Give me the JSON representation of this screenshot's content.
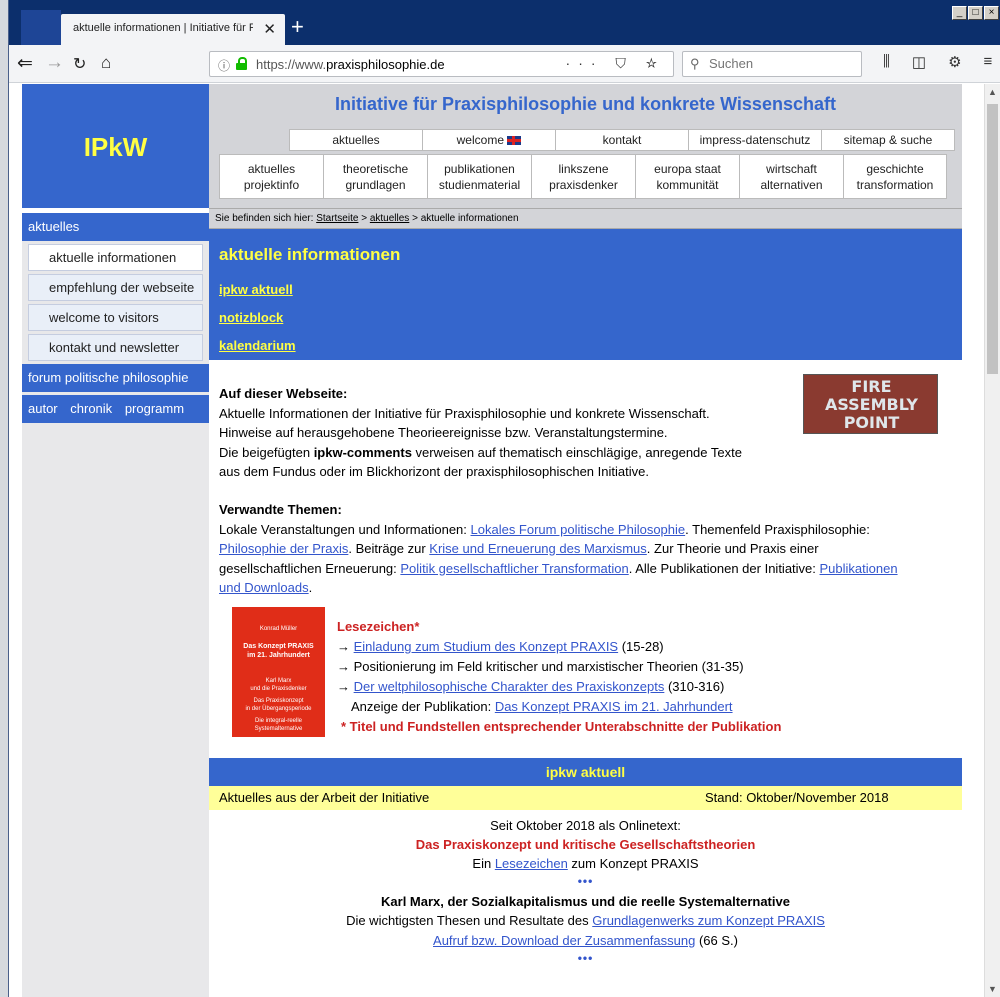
{
  "browser": {
    "tab_title": "aktuelle informationen | Initiative für Pr",
    "tab_close": "✕",
    "new_tab": "+",
    "url_prefix": "https://www.",
    "url_domain": "praxisphilosophie.de",
    "url_actions": "··· ⛉ ☆",
    "search_placeholder": "Suchen"
  },
  "site": {
    "logo": "IPkW",
    "title": "Initiative für Praxisphilosophie und konkrete Wissenschaft"
  },
  "nav_top": [
    "aktuelles",
    "welcome",
    "kontakt",
    "impress-datenschutz",
    "sitemap & suche"
  ],
  "nav_main": [
    {
      "l1": "aktuelles",
      "l2": "projektinfo"
    },
    {
      "l1": "theoretische",
      "l2": "grundlagen"
    },
    {
      "l1": "publikationen",
      "l2": "studienmaterial"
    },
    {
      "l1": "linkszene",
      "l2": "praxisdenker"
    },
    {
      "l1": "europa staat",
      "l2": "kommunität"
    },
    {
      "l1": "wirtschaft",
      "l2": "alternativen"
    },
    {
      "l1": "geschichte",
      "l2": "transformation"
    }
  ],
  "sidebar": {
    "head": "aktuelles",
    "items": [
      "aktuelle informationen",
      "empfehlung der webseite",
      "welcome to visitors",
      "kontakt und newsletter"
    ],
    "forum": "forum politische philosophie",
    "bottom": [
      "autor",
      "chronik",
      "programm"
    ]
  },
  "breadcrumb": {
    "prefix": "Sie befinden sich hier:",
    "home": "Startseite",
    "sep": ">",
    "section": "aktuelles",
    "current": "aktuelle informationen"
  },
  "hero": {
    "title": "aktuelle informationen",
    "links": [
      "ipkw aktuell",
      "notizblock",
      "kalendarium"
    ]
  },
  "intro": {
    "heading": "Auf dieser Webseite:",
    "line1": "Aktuelle Informationen der Initiative für Praxisphilosophie und konkrete Wissenschaft.",
    "line2": "Hinweise auf herausgehobene Theorieereignisse bzw. Veranstaltungstermine.",
    "line3a": "Die beigefügten ",
    "line3b": "ipkw-comments",
    "line3c": " verweisen auf thematisch einschlägige, anregende Texte",
    "line4": "aus dem Fundus oder im Blickhorizont der praxisphilosophischen Initiative."
  },
  "image_sign": {
    "l1": "FIRE",
    "l2": "ASSEMBLY",
    "l3": "POINT"
  },
  "related": {
    "heading": "Verwandte Themen:",
    "t1": "Lokale Veranstaltungen und Informationen: ",
    "a1": "Lokales Forum politische Philosophie",
    "t2": ". Themenfeld Praxisphilosophie:",
    "a2": "Philosophie der Praxis",
    "t3": ". Beiträge zur ",
    "a3": "Krise und Erneuerung des Marxismus",
    "t4": ". Zur Theorie und Praxis einer",
    "t5": "gesellschaftlichen Erneuerung: ",
    "a4": "Politik gesellschaftlicher Transformation",
    "t6": ".  Alle Publikationen der Initiative: ",
    "a5": "Publikationen",
    "a5b": "und Downloads",
    "t7": "."
  },
  "book": {
    "author": "Konrad Müller",
    "title1": "Das Konzept PRAXIS",
    "title2": "im 21. Jahrhundert",
    "sub1": "Karl Marx",
    "sub2": "und die Praxisdenker",
    "sub3": "Das Praxiskonzept",
    "sub4": "in der Übergangsperiode",
    "sub5": "Die integral-reelle",
    "sub6": "Systemalternative"
  },
  "bookmarks": {
    "heading": "Lesezeichen*",
    "arrow": "→",
    "b1_link": "Einladung zum Studium des Konzept PRAXIS",
    "b1_pages": " (15-28)",
    "b2_text": "Positionierung im Feld kritischer und marxistischer Theorien (31-35)",
    "b3_link": "Der weltphilosophische Charakter des Praxiskonzepts",
    "b3_pages": " (310-316)",
    "ad_text": "Anzeige der Publikation: ",
    "ad_link": "Das Konzept PRAXIS im 21. Jahrhundert",
    "note": "* Titel und Fundstellen entsprechender Unterabschnitte der Publikation"
  },
  "aktuell": {
    "bar": "ipkw aktuell",
    "left": "Aktuelles aus der Arbeit der Initiative",
    "right": "Stand: Oktober/November 2018",
    "l1": "Seit Oktober 2018 als Onlinetext:",
    "l2": "Das Praxiskonzept und kritische Gesellschaftstheorien",
    "l3a": "Ein  ",
    "l3link": "Lesezeichen",
    "l3b": " zum Konzept PRAXIS",
    "dots": "•••",
    "l4": "Karl Marx, der Sozialkapitalismus und die reelle Systemalternative",
    "l5a": "Die wichtigsten Thesen und Resultate des ",
    "l5link": "Grundlagenwerks zum Konzept PRAXIS",
    "l6link": "Aufruf bzw. Download der Zusammenfassung",
    "l6b": " (66 S.)"
  }
}
